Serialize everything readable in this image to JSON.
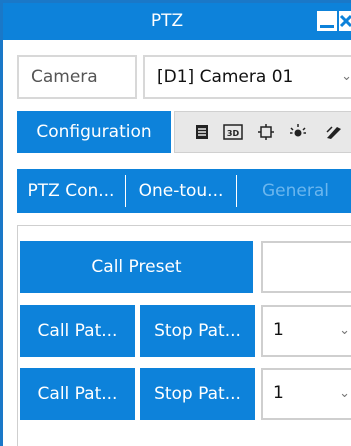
{
  "window": {
    "title": "PTZ",
    "minimize_icon": "minimize-icon",
    "close_icon": "close-icon"
  },
  "camera": {
    "label": "Camera",
    "selected": "[D1] Camera 01",
    "chevron": "⌄"
  },
  "config": {
    "button_label": "Configuration",
    "icons": [
      "list-icon",
      "3d-icon",
      "focus-frame-icon",
      "light-icon",
      "wiper-icon"
    ]
  },
  "tabs": [
    {
      "label": "PTZ Con...",
      "enabled": true
    },
    {
      "label": "One-tou...",
      "enabled": true
    },
    {
      "label": "General",
      "enabled": false
    }
  ],
  "preset": {
    "button_label": "Call Preset",
    "input_value": ""
  },
  "patrol_rows": [
    {
      "call_label": "Call Pat...",
      "stop_label": "Stop Pat...",
      "value": "1",
      "chevron": "⌄"
    },
    {
      "call_label": "Call Pat...",
      "stop_label": "Stop Pat...",
      "value": "1",
      "chevron": "⌄"
    }
  ],
  "colors": {
    "accent": "#0d82da",
    "border": "#cfcfcf",
    "disabled_text": "#6bb6ee"
  }
}
